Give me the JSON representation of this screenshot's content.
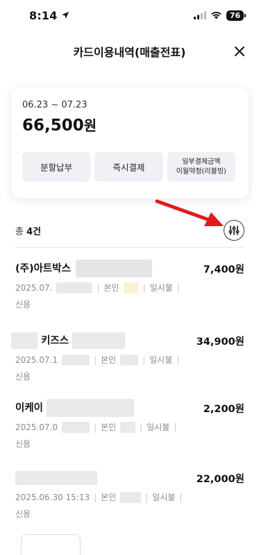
{
  "status_bar": {
    "time": "8:14",
    "battery": "76"
  },
  "header": {
    "title": "카드이용내역(매출전표)",
    "close_label": "×"
  },
  "summary": {
    "period": "06.23 ~ 07.23",
    "total_amount": "66,500",
    "currency_unit": "원",
    "actions": [
      {
        "label": "분할납부"
      },
      {
        "label": "즉시결제"
      },
      {
        "label_line1": "일부결제금액",
        "label_line2": "이월약정(리볼빙)"
      }
    ]
  },
  "list": {
    "count_prefix": "총 ",
    "count": "4건"
  },
  "transactions": [
    {
      "merchant": "(주)아트박스",
      "amount": "7,400원",
      "date": "2025.07.",
      "holder": "본인",
      "payment": "일시불",
      "kind": "신용"
    },
    {
      "merchant": "키즈스",
      "amount": "34,900원",
      "date": "2025.07.1",
      "holder": "본인",
      "payment": "일시불",
      "kind": "신용"
    },
    {
      "merchant": "이케이",
      "amount": "2,200원",
      "date": "2025.07.0",
      "holder": "본인",
      "payment": "일시불",
      "kind": "신용"
    },
    {
      "merchant": "",
      "amount": "22,000원",
      "date": "2025.06.30 15:13",
      "holder": "본인",
      "payment": "일시불",
      "kind": "신용"
    }
  ]
}
